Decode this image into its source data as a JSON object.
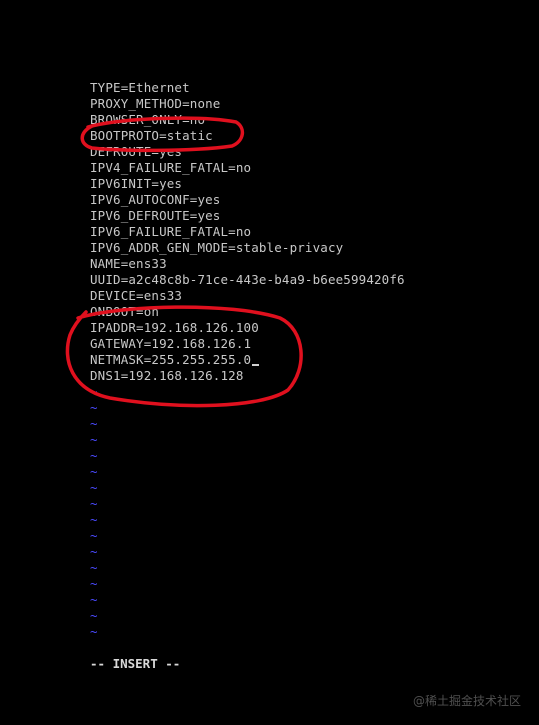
{
  "editor": {
    "lines": [
      "TYPE=Ethernet",
      "PROXY_METHOD=none",
      "BROWSER_ONLY=no",
      "BOOTPROTO=static",
      "DEFROUTE=yes",
      "IPV4_FAILURE_FATAL=no",
      "IPV6INIT=yes",
      "IPV6_AUTOCONF=yes",
      "IPV6_DEFROUTE=yes",
      "IPV6_FAILURE_FATAL=no",
      "IPV6_ADDR_GEN_MODE=stable-privacy",
      "NAME=ens33",
      "UUID=a2c48c8b-71ce-443e-b4a9-b6ee599420f6",
      "DEVICE=ens33",
      "ONBOOT=on",
      "IPADDR=192.168.126.100",
      "GATEWAY=192.168.126.1",
      "NETMASK=255.255.255.0",
      "DNS1=192.168.126.128"
    ],
    "tilde": "~",
    "empty_line_count": 16
  },
  "status": {
    "mode": "-- INSERT --"
  },
  "watermark": {
    "text": "@稀土掘金技术社区"
  },
  "colors": {
    "background": "#000000",
    "text": "#c8c8c8",
    "tilde": "#4a4aff",
    "annotation": "#e0101e"
  }
}
